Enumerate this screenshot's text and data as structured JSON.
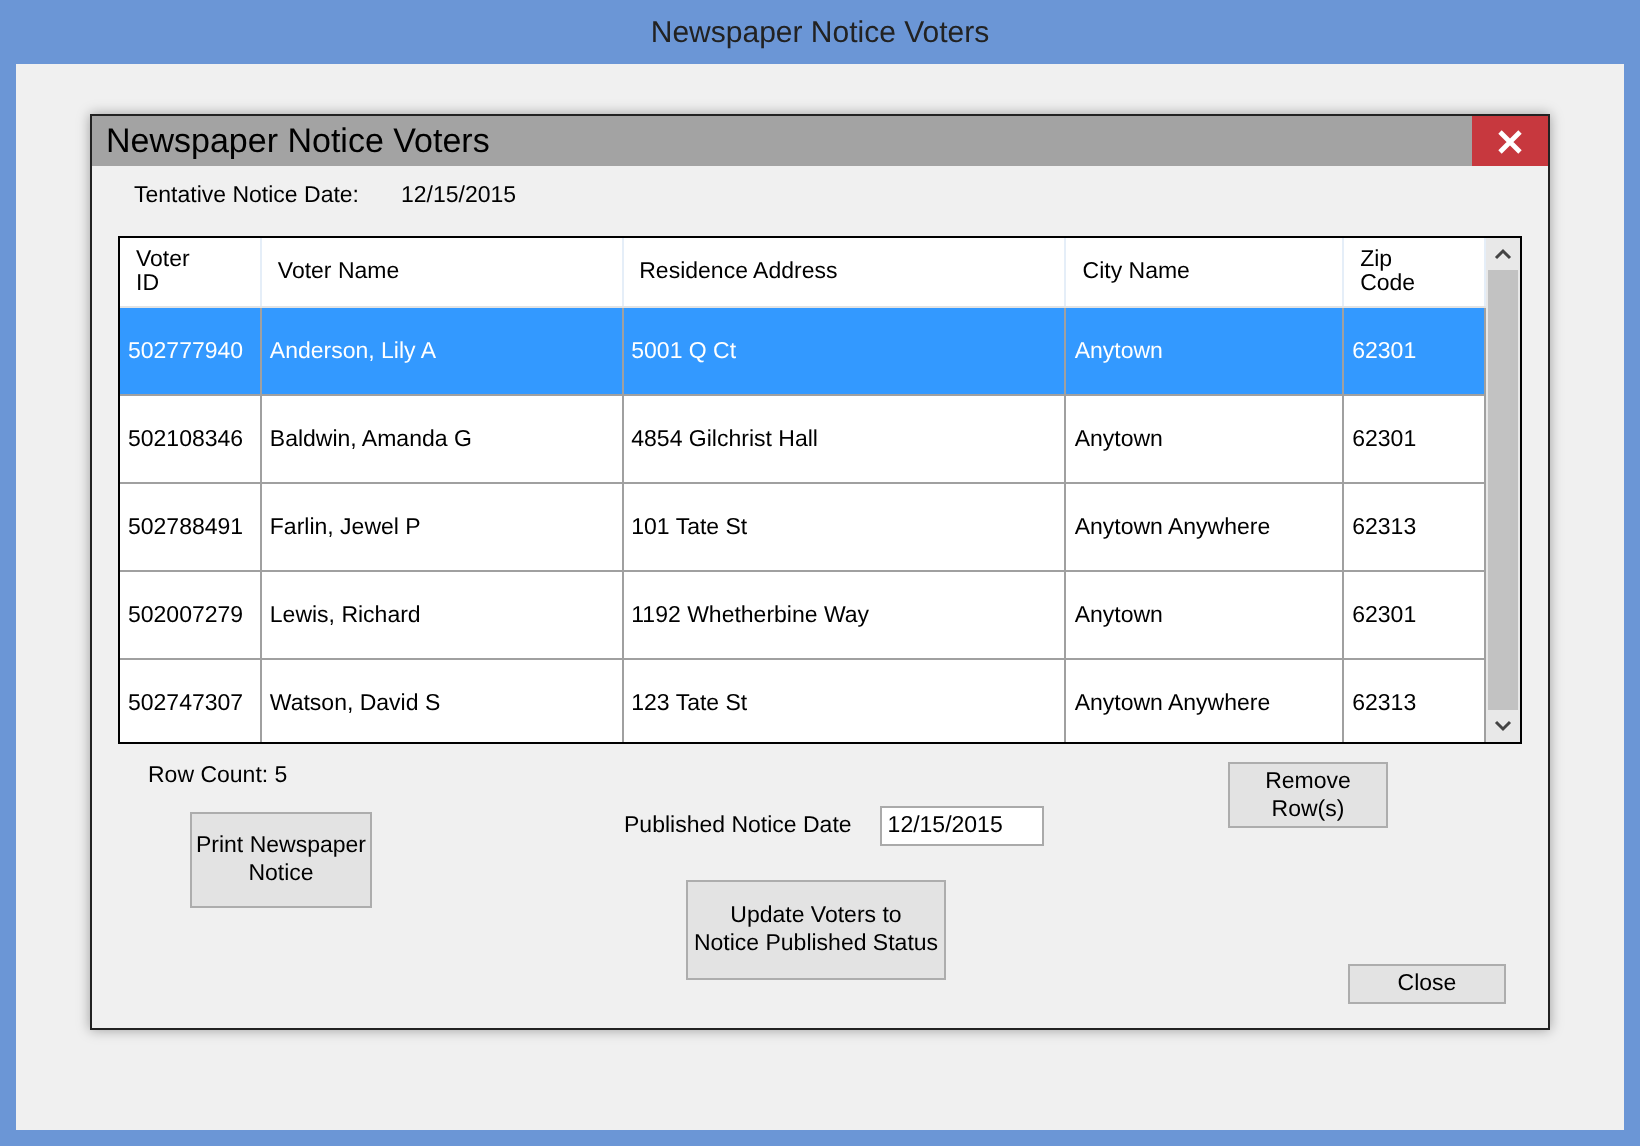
{
  "window": {
    "title": "Newspaper Notice Voters"
  },
  "dialog": {
    "title": "Newspaper Notice Voters"
  },
  "tentative": {
    "label": "Tentative Notice Date:",
    "value": "12/15/2015"
  },
  "table": {
    "columns": [
      "Voter\nID",
      "Voter Name",
      "Residence Address",
      "City Name",
      "Zip\nCode"
    ],
    "rows": [
      {
        "selected": true,
        "cells": [
          "502777940",
          "Anderson, Lily A",
          "5001 Q Ct",
          "Anytown",
          "62301"
        ]
      },
      {
        "selected": false,
        "cells": [
          "502108346",
          "Baldwin, Amanda G",
          "4854 Gilchrist Hall",
          "Anytown",
          "62301"
        ]
      },
      {
        "selected": false,
        "cells": [
          "502788491",
          "Farlin, Jewel P",
          "101 Tate St",
          "Anytown Anywhere",
          "62313"
        ]
      },
      {
        "selected": false,
        "cells": [
          "502007279",
          "Lewis, Richard",
          "1192 Whetherbine Way",
          "Anytown",
          "62301"
        ]
      },
      {
        "selected": false,
        "cells": [
          "502747307",
          "Watson, David S",
          "123 Tate St",
          "Anytown Anywhere",
          "62313"
        ]
      }
    ]
  },
  "row_count": "Row Count: 5",
  "print_button": "Print Newspaper\nNotice",
  "published": {
    "label": "Published Notice Date",
    "value": "12/15/2015"
  },
  "update_button": "Update Voters to\nNotice Published Status",
  "remove_button": "Remove\nRow(s)",
  "close_button": "Close"
}
